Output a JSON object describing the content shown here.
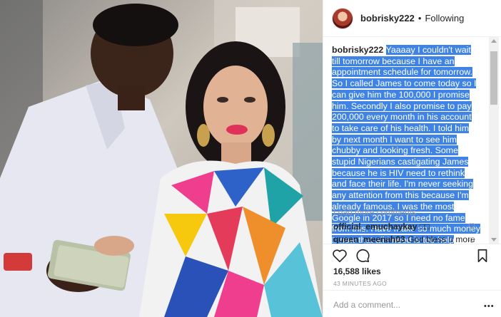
{
  "post": {
    "username": "bobrisky222",
    "separator": "•",
    "follow_status": "Following"
  },
  "caption": {
    "username": "bobrisky222",
    "text": "Yaaaay I couldn't wait till tomorrow because I have an appointment schedule for tomorrow. So I called James to come today so I can give him the 100,000 I promise him. Secondly I also promise to pay 200,000 every month in his account to take care of his health. I told him by next month I want to see him chubby and looking fresh. Some stupid Nigerians castigating James because he is HIV need to rethink and face their life. I'm never seeking any attention from this because I'm already famous. I was the most Google in 2017 so I need no fame from this. Have make so much money □ now that all I need is too help people not to find fame. Have a wonderful day ❤"
  },
  "comments": {
    "load_more": "Load more comments",
    "items": [
      {
        "username": "official_emuchaykay",
        "text": "□□"
      },
      {
        "username": "queen_meenah03",
        "text": "God bless u more"
      }
    ]
  },
  "stats": {
    "likes": "16,588 likes",
    "time": "43 MINUTES AGO"
  },
  "add_comment": {
    "placeholder": "Add a comment...",
    "more": "•••"
  },
  "icons": {
    "like": "heart-icon",
    "comment": "comment-icon",
    "save": "bookmark-icon",
    "comment_like": "heart-outline-icon"
  },
  "colors": {
    "selection": "#3f84e4",
    "text": "#262626",
    "muted": "#999999"
  }
}
